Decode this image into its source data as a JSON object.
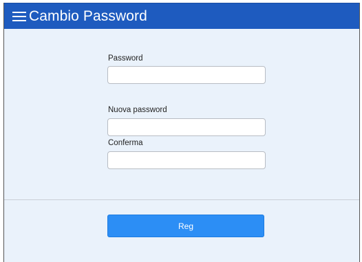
{
  "header": {
    "title": "Cambio Password",
    "menu_icon": "hamburger-menu-icon",
    "background_color": "#1e5bbf"
  },
  "form": {
    "password_label": "Password",
    "password_value": "",
    "new_password_label": "Nuova password",
    "new_password_value": "",
    "confirm_label": "Conferma",
    "confirm_value": ""
  },
  "actions": {
    "submit_label": "Reg",
    "submit_color": "#2c8ef5"
  }
}
